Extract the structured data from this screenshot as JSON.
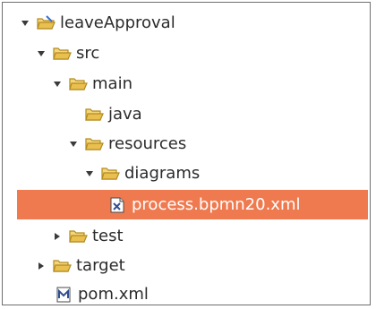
{
  "tree": {
    "items": [
      {
        "label": "leaveApproval",
        "kind": "project",
        "expanded": true,
        "has_children": true
      },
      {
        "label": "src",
        "kind": "folder",
        "expanded": true,
        "has_children": true
      },
      {
        "label": "main",
        "kind": "folder",
        "expanded": true,
        "has_children": true
      },
      {
        "label": "java",
        "kind": "folder",
        "expanded": false,
        "has_children": false
      },
      {
        "label": "resources",
        "kind": "folder",
        "expanded": true,
        "has_children": true
      },
      {
        "label": "diagrams",
        "kind": "folder",
        "expanded": true,
        "has_children": true
      },
      {
        "label": "process.bpmn20.xml",
        "kind": "xml-file",
        "selected": true,
        "has_children": false
      },
      {
        "label": "test",
        "kind": "folder",
        "expanded": false,
        "has_children": true
      },
      {
        "label": "target",
        "kind": "folder",
        "expanded": false,
        "has_children": true
      },
      {
        "label": "pom.xml",
        "kind": "maven-file",
        "has_children": false
      }
    ]
  },
  "colors": {
    "selection": "#ef7a50",
    "folder": "#e7b442",
    "text": "#2b2b2b"
  }
}
